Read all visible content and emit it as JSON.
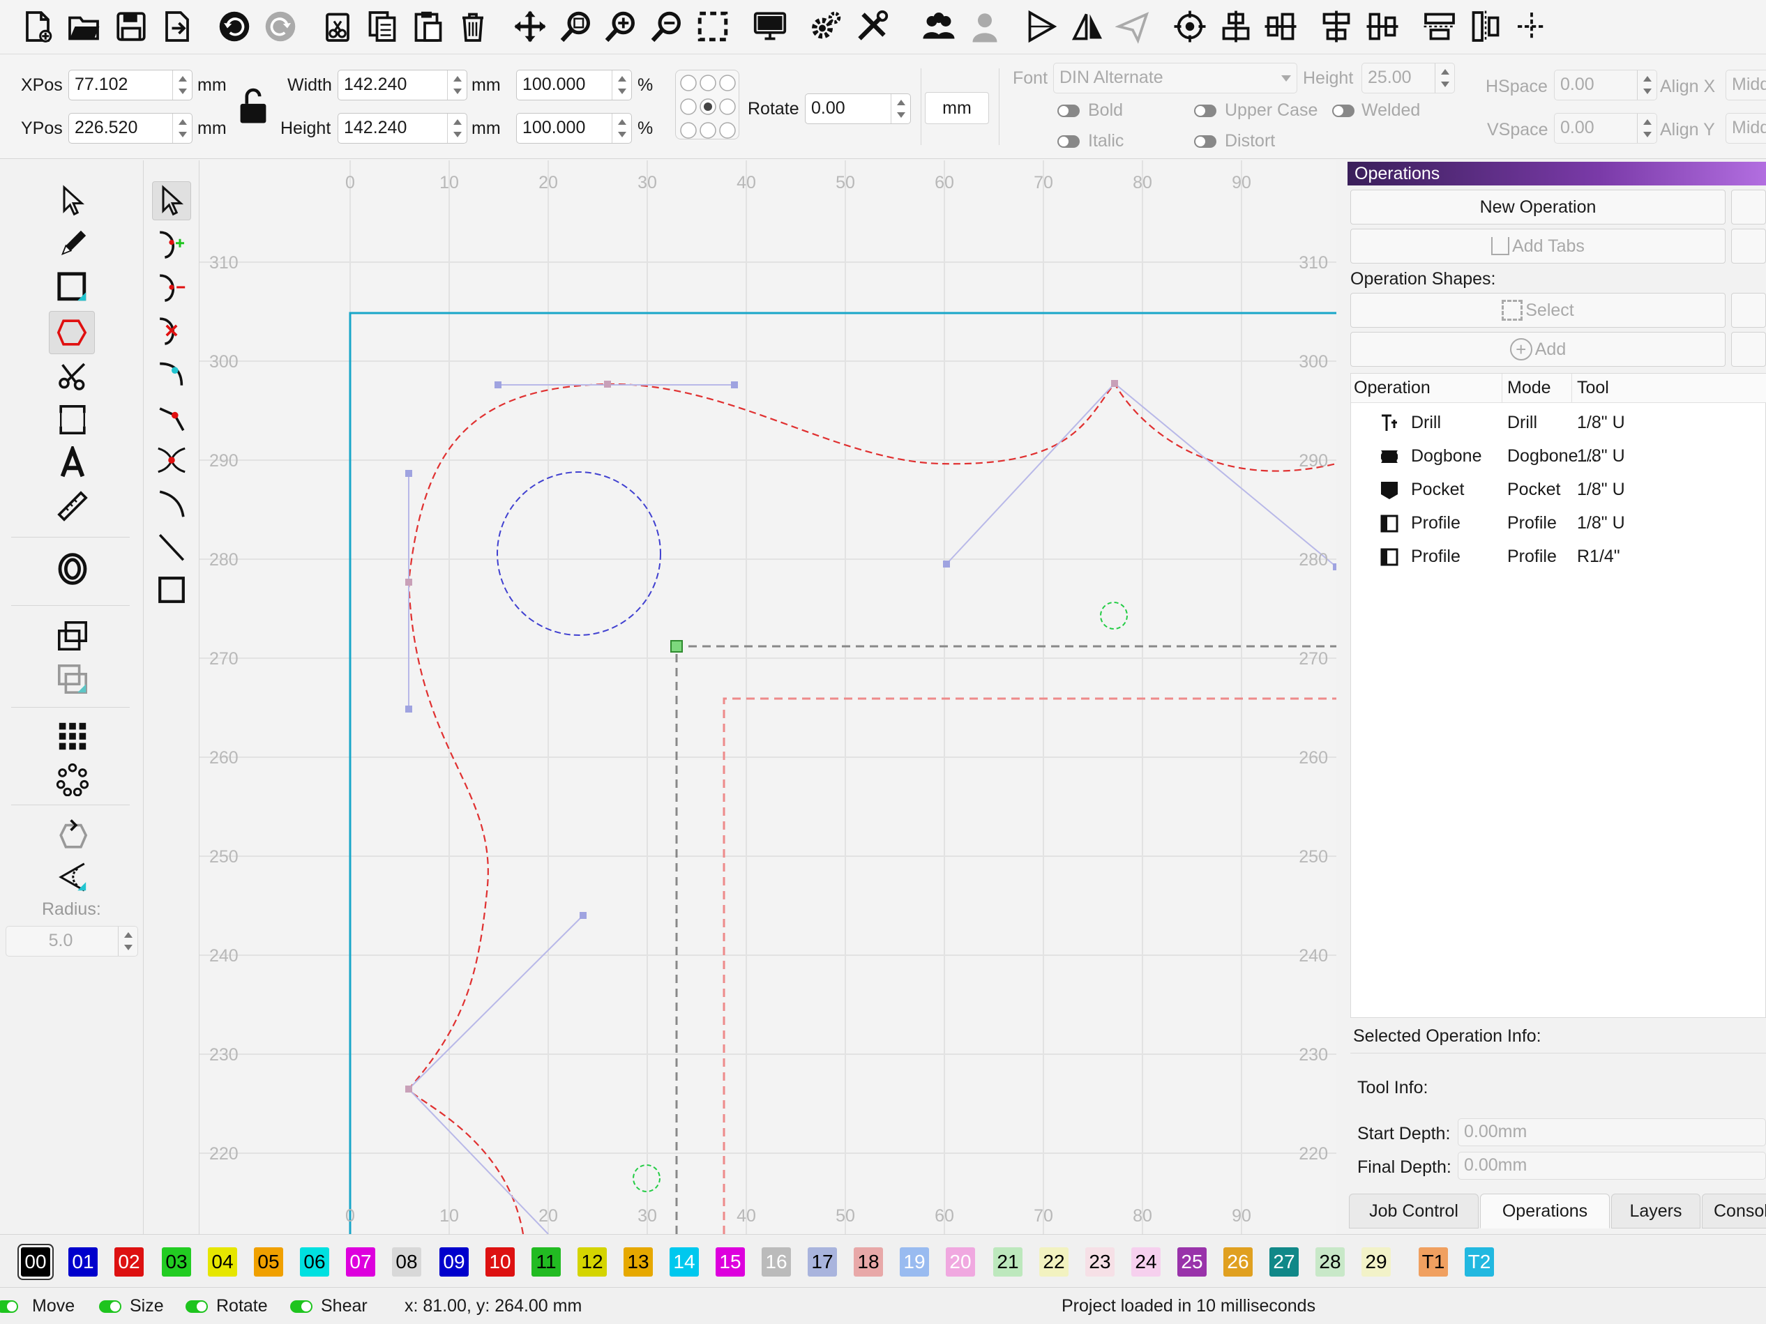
{
  "toolbar": {
    "icons": [
      "new-file-icon",
      "open-folder-icon",
      "save-icon",
      "export-icon",
      "undo-icon",
      "redo-icon",
      "cut-icon",
      "copy-icon",
      "paste-icon",
      "delete-icon",
      "move-icon",
      "zoom-fit-icon",
      "zoom-in-icon",
      "zoom-out-icon",
      "select-all-icon",
      "display-icon",
      "settings-icon",
      "tools-icon",
      "group-icon",
      "user-icon",
      "send-icon",
      "mirror-icon",
      "plane-icon",
      "target-icon",
      "align-left-icon",
      "align-center-icon",
      "distribute-h-icon",
      "distribute-v-icon",
      "spacing-h-icon",
      "spacing-v-icon",
      "snap-icon"
    ]
  },
  "props": {
    "xpos_label": "XPos",
    "xpos_value": "77.102",
    "xpos_unit": "mm",
    "ypos_label": "YPos",
    "ypos_value": "226.520",
    "ypos_unit": "mm",
    "width_label": "Width",
    "width_value": "142.240",
    "width_unit": "mm",
    "width_pct": "100.000",
    "pct": "%",
    "height_label": "Height",
    "height_value": "142.240",
    "height_unit": "mm",
    "height_pct": "100.000",
    "rotate_label": "Rotate",
    "rotate_value": "0.00",
    "unit_button": "mm",
    "font_label": "Font",
    "font_value": "DIN Alternate",
    "fheight_label": "Height",
    "fheight_value": "25.00",
    "bold": "Bold",
    "italic": "Italic",
    "upper_case": "Upper Case",
    "welded": "Welded",
    "distort": "Distort",
    "hspace_label": "HSpace",
    "hspace_value": "0.00",
    "vspace_label": "VSpace",
    "vspace_value": "0.00",
    "alignx_label": "Align X",
    "alignx_value": "Midd",
    "aligny_label": "Align Y",
    "aligny_value": "Midd"
  },
  "left_tools": {
    "radius_label": "Radius:",
    "radius_value": "5.0"
  },
  "canvas": {
    "top_ruler": [
      "0",
      "10",
      "20",
      "30",
      "40",
      "50",
      "60",
      "70",
      "80",
      "90"
    ],
    "bottom_ruler": [
      "0",
      "10",
      "20",
      "30",
      "40",
      "50",
      "60",
      "70",
      "80",
      "90"
    ],
    "left_ruler": [
      "310",
      "300",
      "290",
      "280",
      "270",
      "260",
      "250",
      "240",
      "230",
      "220"
    ],
    "right_ruler": [
      "310",
      "300",
      "290",
      "280",
      "270",
      "260",
      "250",
      "240",
      "230",
      "220"
    ]
  },
  "panel": {
    "header": "Operations",
    "new_operation": "New Operation",
    "add_tabs": "Add Tabs",
    "operation_shapes": "Operation Shapes:",
    "select": "Select",
    "add": "Add",
    "columns": [
      "Operation",
      "Mode",
      "Tool"
    ],
    "operations": [
      {
        "name": "Drill",
        "mode": "Drill",
        "tool": "1/8\" U",
        "icon": "drill-icon"
      },
      {
        "name": "Dogbone",
        "mode": "Dogbone ...",
        "tool": "1/8\" U",
        "icon": "dogbone-icon"
      },
      {
        "name": "Pocket",
        "mode": "Pocket",
        "tool": "1/8\" U",
        "icon": "pocket-icon"
      },
      {
        "name": "Profile",
        "mode": "Profile",
        "tool": "1/8\" U",
        "icon": "profile-icon"
      },
      {
        "name": "Profile",
        "mode": "Profile",
        "tool": "R1/4\"",
        "icon": "profile-icon"
      }
    ],
    "selected_info": "Selected Operation Info:",
    "tool_info": "Tool Info:",
    "start_depth_label": "Start Depth:",
    "start_depth_value": "0.00mm",
    "final_depth_label": "Final Depth:",
    "final_depth_value": "0.00mm",
    "tabs": [
      "Job Control",
      "Operations",
      "Layers",
      "Consol"
    ]
  },
  "layers": [
    {
      "label": "00",
      "bg": "#000000",
      "fg": "#ffffff"
    },
    {
      "label": "01",
      "bg": "#0000cc",
      "fg": "#ffffff"
    },
    {
      "label": "02",
      "bg": "#dd1111",
      "fg": "#ffffff"
    },
    {
      "label": "03",
      "bg": "#22cc22",
      "fg": "#000000"
    },
    {
      "label": "04",
      "bg": "#e6e600",
      "fg": "#000000"
    },
    {
      "label": "05",
      "bg": "#f0a000",
      "fg": "#000000"
    },
    {
      "label": "06",
      "bg": "#00e0e0",
      "fg": "#000000"
    },
    {
      "label": "07",
      "bg": "#dd00dd",
      "fg": "#ffffff"
    },
    {
      "label": "08",
      "bg": "#d8d8d8",
      "fg": "#000000"
    },
    {
      "label": "09",
      "bg": "#0000cc",
      "fg": "#ffffff"
    },
    {
      "label": "10",
      "bg": "#dd1111",
      "fg": "#ffffff"
    },
    {
      "label": "11",
      "bg": "#22bb22",
      "fg": "#000000"
    },
    {
      "label": "12",
      "bg": "#d4d400",
      "fg": "#000000"
    },
    {
      "label": "13",
      "bg": "#e6a800",
      "fg": "#000000"
    },
    {
      "label": "14",
      "bg": "#00c8ee",
      "fg": "#ffffff"
    },
    {
      "label": "15",
      "bg": "#dd00dd",
      "fg": "#ffffff"
    },
    {
      "label": "16",
      "bg": "#bbbbbb",
      "fg": "#ffffff"
    },
    {
      "label": "17",
      "bg": "#a9b4dd",
      "fg": "#000000"
    },
    {
      "label": "18",
      "bg": "#e8a8a8",
      "fg": "#000000"
    },
    {
      "label": "19",
      "bg": "#99bbf0",
      "fg": "#ffffff"
    },
    {
      "label": "20",
      "bg": "#f0a8e0",
      "fg": "#ffffff"
    },
    {
      "label": "21",
      "bg": "#bde8bd",
      "fg": "#000000"
    },
    {
      "label": "22",
      "bg": "#f2f2c0",
      "fg": "#000000"
    },
    {
      "label": "23",
      "bg": "#f6e0e6",
      "fg": "#000000"
    },
    {
      "label": "24",
      "bg": "#f6d0ee",
      "fg": "#000000"
    },
    {
      "label": "25",
      "bg": "#9933aa",
      "fg": "#ffffff"
    },
    {
      "label": "26",
      "bg": "#e0a020",
      "fg": "#ffffff"
    },
    {
      "label": "27",
      "bg": "#118888",
      "fg": "#ffffff"
    },
    {
      "label": "28",
      "bg": "#c8e8c8",
      "fg": "#000000"
    },
    {
      "label": "29",
      "bg": "#f2f2c8",
      "fg": "#000000"
    },
    {
      "label": "T1",
      "bg": "#f0a060",
      "fg": "#000000"
    },
    {
      "label": "T2",
      "bg": "#22b8e0",
      "fg": "#ffffff"
    }
  ],
  "status": {
    "move": "Move",
    "size": "Size",
    "rotate": "Rotate",
    "shear": "Shear",
    "coords": "x: 81.00, y: 264.00 mm",
    "message": "Project loaded in 10 milliseconds"
  }
}
